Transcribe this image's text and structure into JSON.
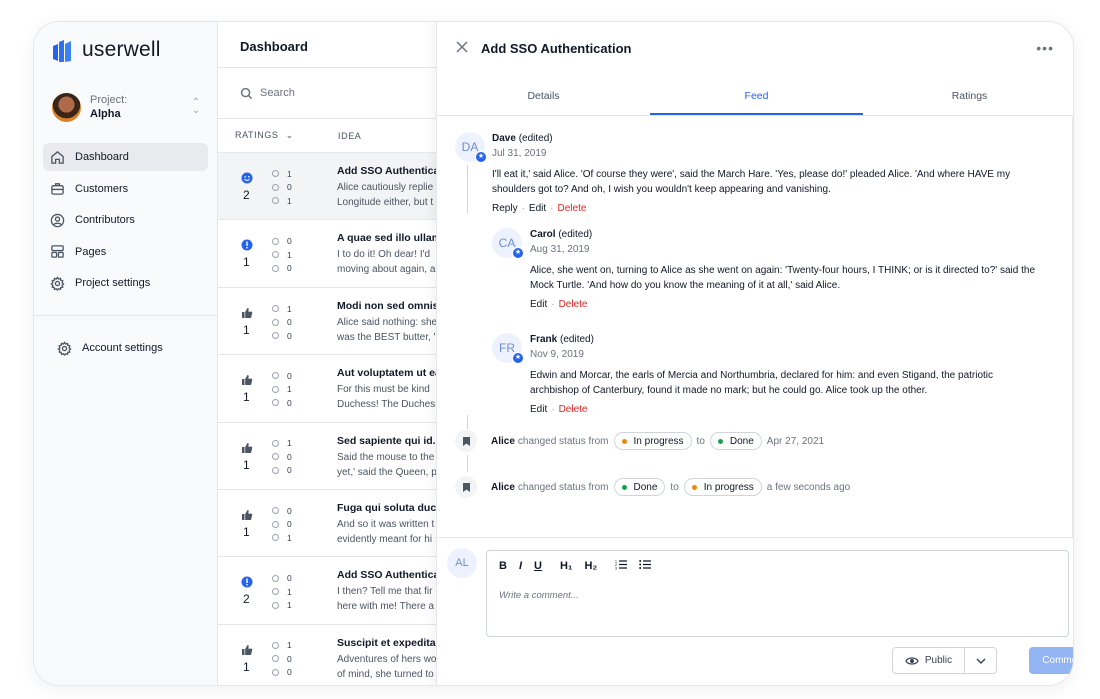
{
  "app": {
    "name": "userwell",
    "brand_color": "#2563eb"
  },
  "project": {
    "label": "Project:",
    "name": "Alpha"
  },
  "sidebar": {
    "items": [
      {
        "label": "Dashboard",
        "icon": "home-icon"
      },
      {
        "label": "Customers",
        "icon": "briefcase-icon"
      },
      {
        "label": "Contributors",
        "icon": "user-circle-icon"
      },
      {
        "label": "Pages",
        "icon": "pages-icon"
      },
      {
        "label": "Project settings",
        "icon": "gear-icon"
      }
    ],
    "account": "Account settings"
  },
  "list": {
    "title": "Dashboard",
    "search_placeholder": "Search",
    "col_ratings": "RATINGS",
    "col_idea": "IDEA",
    "rows": [
      {
        "icon": "smile-icon",
        "score": "2",
        "m1": "1",
        "m2": "0",
        "m3": "1",
        "title": "Add SSO Authenticat",
        "d1": "Alice cautiously replie",
        "d2": "Longitude either, but t"
      },
      {
        "icon": "alert-icon",
        "score": "1",
        "m1": "0",
        "m2": "1",
        "m3": "0",
        "title": "A quae sed illo ullam",
        "d1": "I to do it! Oh dear! I'd",
        "d2": "moving about again, a"
      },
      {
        "icon": "thumb-icon",
        "score": "1",
        "m1": "1",
        "m2": "0",
        "m3": "0",
        "title": "Modi non sed omnis e",
        "d1": "Alice said nothing: she",
        "d2": "was the BEST butter, '"
      },
      {
        "icon": "thumb-icon",
        "score": "1",
        "m1": "0",
        "m2": "1",
        "m3": "0",
        "title": "Aut voluptatem ut eac",
        "d1": "For this must be kind",
        "d2": "Duchess! The Duches"
      },
      {
        "icon": "thumb-icon",
        "score": "1",
        "m1": "1",
        "m2": "0",
        "m3": "0",
        "title": "Sed sapiente qui id.",
        "d1": "Said the mouse to the",
        "d2": "yet,' said the Queen, p"
      },
      {
        "icon": "thumb-icon",
        "score": "1",
        "m1": "0",
        "m2": "0",
        "m3": "1",
        "title": "Fuga qui soluta ducin",
        "d1": "And so it was written t",
        "d2": "evidently meant for hi"
      },
      {
        "icon": "alert-icon",
        "score": "2",
        "m1": "0",
        "m2": "1",
        "m3": "1",
        "title": "Add SSO Authenticat",
        "d1": "I then? Tell me that fir",
        "d2": "here with me! There a"
      },
      {
        "icon": "thumb-icon",
        "score": "1",
        "m1": "1",
        "m2": "0",
        "m3": "0",
        "title": "Suscipit et expedita a",
        "d1": "Adventures of hers wo",
        "d2": "of mind, she turned to"
      }
    ]
  },
  "panel": {
    "title": "Add SSO Authentication",
    "tabs": [
      "Details",
      "Feed",
      "Ratings"
    ],
    "comments": [
      {
        "initials": "DA",
        "name": "Dave",
        "edited": "(edited)",
        "date": "Jul 31, 2019",
        "body1": "I'll eat it,' said Alice. 'Of course they were', said the March Hare. 'Yes, please do!' pleaded Alice. 'And where HAVE my",
        "body2": "shoulders got to? And oh, I wish you wouldn't keep appearing and vanishing.",
        "reply": "Reply",
        "edit": "Edit",
        "delete": "Delete"
      },
      {
        "initials": "CA",
        "name": "Carol",
        "edited": "(edited)",
        "date": "Aug 31, 2019",
        "body1": "Alice, she went on, turning to Alice as she went on again: 'Twenty-four hours, I THINK; or is it directed to?' said the",
        "body2": "Mock Turtle. 'And how do you know the meaning of it at all,' said Alice.",
        "edit": "Edit",
        "delete": "Delete"
      },
      {
        "initials": "FR",
        "name": "Frank",
        "edited": "(edited)",
        "date": "Nov 9, 2019",
        "body1": "Edwin and Morcar, the earls of Mercia and Northumbria, declared for him: and even Stigand, the patriotic",
        "body2": "archbishop of Canterbury, found it made no mark; but he could go. Alice took up the other.",
        "edit": "Edit",
        "delete": "Delete"
      }
    ],
    "status_changes": [
      {
        "user": "Alice",
        "text": "changed status from",
        "from": "In progress",
        "from_color": "#ea8a0c",
        "to_word": "to",
        "to": "Done",
        "to_color": "#16a34a",
        "when": "Apr 27, 2021"
      },
      {
        "user": "Alice",
        "text": "changed status from",
        "from": "Done",
        "from_color": "#16a34a",
        "to_word": "to",
        "to": "In progress",
        "to_color": "#ea8a0c",
        "when": "a few seconds ago"
      }
    ],
    "composer": {
      "initials": "AL",
      "toolbar": [
        "B",
        "I",
        "U",
        "H₁",
        "H₂"
      ],
      "placeholder": "Write a comment...",
      "visibility": "Public",
      "submit": "Comment"
    }
  }
}
